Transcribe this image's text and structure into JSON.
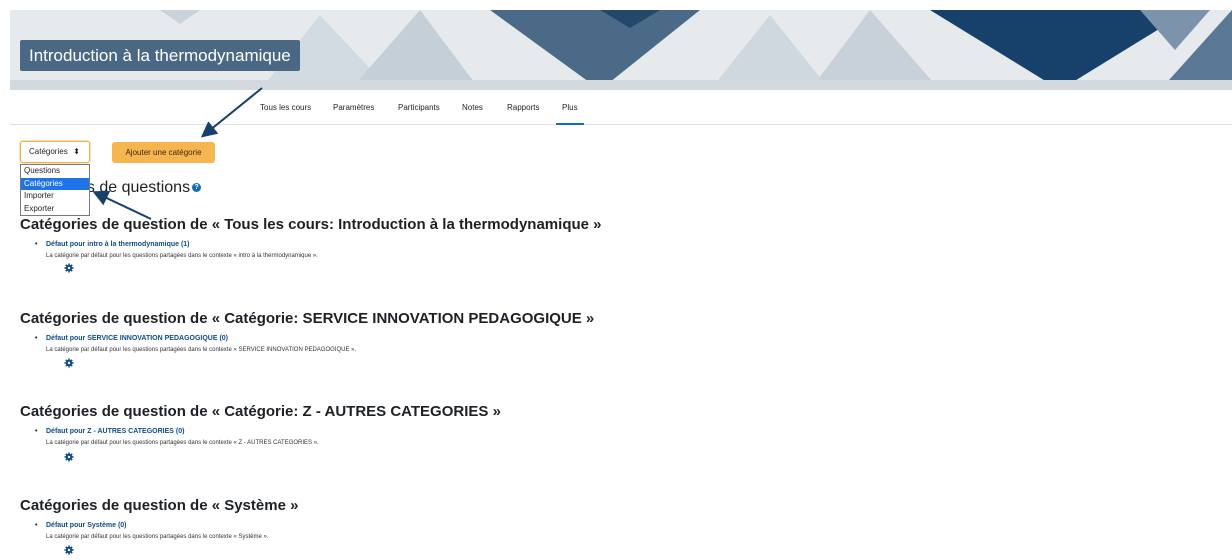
{
  "header": {
    "course_title": "Introduction à la thermodynamique"
  },
  "nav": {
    "items": [
      {
        "label": "Tous les cours"
      },
      {
        "label": "Paramètres"
      },
      {
        "label": "Participants"
      },
      {
        "label": "Notes"
      },
      {
        "label": "Rapports"
      },
      {
        "label": "Plus"
      }
    ],
    "active": "Plus"
  },
  "actions": {
    "select_value": "Catégories",
    "select_options": [
      "Questions",
      "Catégories",
      "Importer",
      "Exporter"
    ],
    "add_category_label": "Ajouter une catégorie"
  },
  "page": {
    "title_visible": "es de questions",
    "help_icon": "question-circle-icon"
  },
  "sections": [
    {
      "heading": "Catégories de question de « Tous les cours: Introduction à la thermodynamique »",
      "category": "Défaut pour intro à la thermodynamique (1)",
      "description": "La catégorie par défaut pour les questions partagées dans le contexte « intro à la thermodynamique ».",
      "icon": "gear-icon"
    },
    {
      "heading": "Catégories de question de « Catégorie: SERVICE INNOVATION PEDAGOGIQUE »",
      "category": "Défaut pour SERVICE INNOVATION PEDAGOGIQUE (0)",
      "description": "La catégorie par défaut pour les questions partagées dans le contexte « SERVICE INNOVATION PEDAGOGIQUE ».",
      "icon": "gear-icon"
    },
    {
      "heading": "Catégories de question de « Catégorie: Z - AUTRES CATEGORIES »",
      "category": "Défaut pour Z - AUTRES CATEGORIES (0)",
      "description": "La catégorie par défaut pour les questions partagées dans le contexte « Z - AUTRES CATEGORIES ».",
      "icon": "gear-icon"
    },
    {
      "heading": "Catégories de question de « Système »",
      "category": "Défaut pour Système (0)",
      "description": "La catégorie par défaut pour les questions partagées dans le contexte « Système ».",
      "icon": "gear-icon"
    }
  ],
  "colors": {
    "banner_dark": "#17406b",
    "banner_mid": "#4a6784",
    "link": "#0f4c8a",
    "accent": "#f6b54f",
    "select_highlight": "#1e73e8"
  }
}
